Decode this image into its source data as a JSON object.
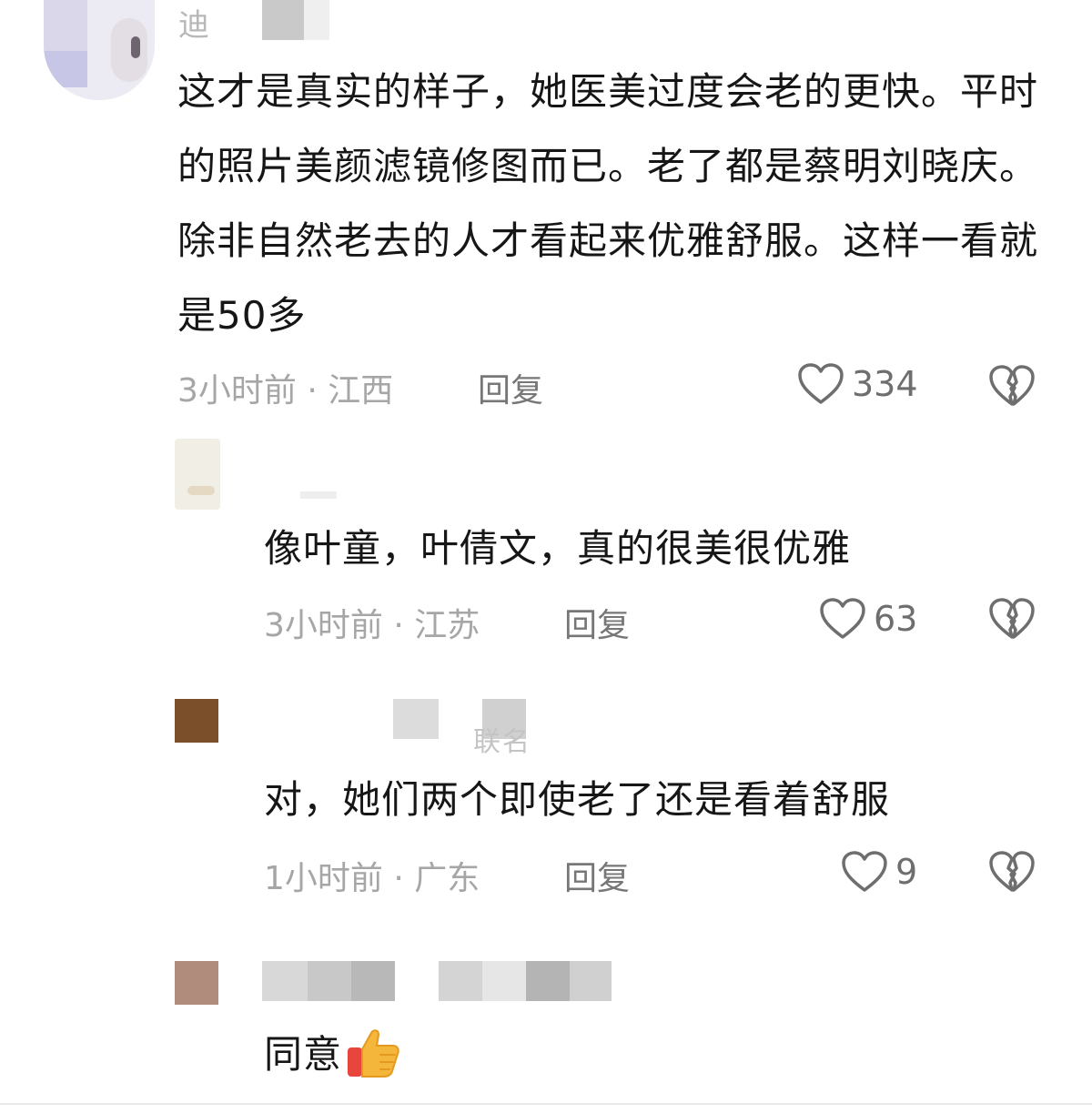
{
  "comments": [
    {
      "username_partial": "迪",
      "text": "这才是真实的样子，她医美过度会老的更快。平时的照片美颜滤镜修图而已。老了都是蔡明刘晓庆。除非自然老去的人才看起来优雅舒服。这样一看就是50多",
      "time_location": "3小时前 · 江西",
      "reply_label": "回复",
      "likes": "334"
    },
    {
      "text": "像叶童，叶倩文，真的很美很优雅",
      "time_location": "3小时前 · 江苏",
      "reply_label": "回复",
      "likes": "63"
    },
    {
      "username_partial": "联名",
      "text": "对，她们两个即使老了还是看着舒服",
      "time_location": "1小时前 · 广东",
      "reply_label": "回复",
      "likes": "9"
    },
    {
      "text": "同意",
      "emoji": "👍"
    }
  ],
  "icons": {
    "like": "heart-outline-icon",
    "dislike": "broken-heart-icon",
    "thumbs_up": "thumbs-up-emoji"
  },
  "colors": {
    "text": "#161616",
    "meta": "#a6a6a6",
    "icon": "#6e6e6e",
    "thumb": "#f5b73b"
  }
}
